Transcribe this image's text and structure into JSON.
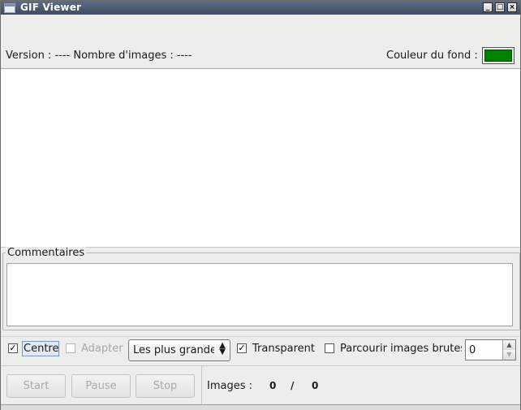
{
  "window": {
    "title": "GIF Viewer",
    "buttons": {
      "minimize": "_",
      "maximize": "□",
      "close": "×"
    }
  },
  "info": {
    "text": "Version : ---- Nombre d'images : ----",
    "background_label": "Couleur du fond :",
    "background_color": "#008000"
  },
  "comments": {
    "legend": "Commentaires",
    "value": ""
  },
  "options": {
    "centre": {
      "label": "Centre",
      "checked": true
    },
    "adapter": {
      "label": "Adapter",
      "checked": false,
      "disabled": true
    },
    "size_select": {
      "value": "Les plus grandes"
    },
    "transparent": {
      "label": "Transparent",
      "checked": true
    },
    "raw_images": {
      "label": "Parcourir images brutes",
      "checked": false
    },
    "spin_value": "0"
  },
  "controls": {
    "start": "Start",
    "pause": "Pause",
    "stop": "Stop",
    "images_label": "Images :",
    "current": "0",
    "separator": "/",
    "total": "0"
  }
}
